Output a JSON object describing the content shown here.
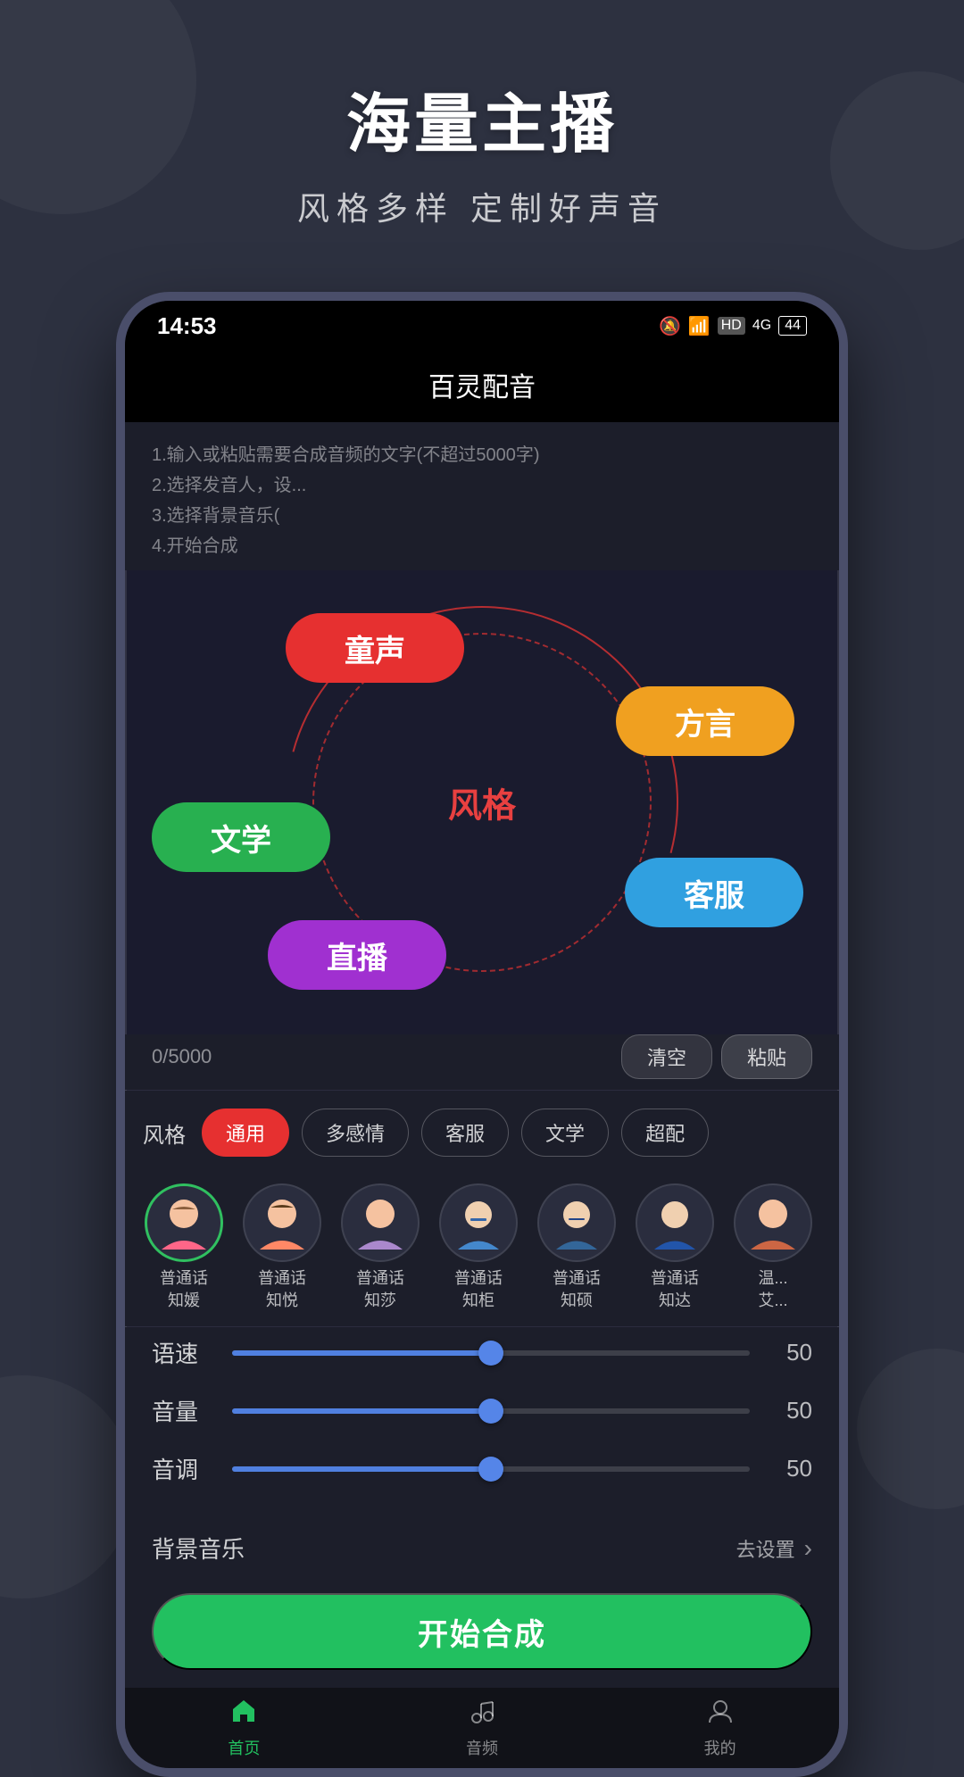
{
  "page": {
    "bg_title": "海量主播",
    "bg_subtitle": "风格多样   定制好声音"
  },
  "status_bar": {
    "time": "14:53",
    "icons": "🔕 📶 HD 4G 🔋"
  },
  "app_header": {
    "title": "百灵配音"
  },
  "instructions": {
    "lines": [
      "1.输入或粘贴需要合成音频的文字(不超过5000字)",
      "2.选择发音人，设...",
      "3.选择背景音乐(",
      "4.开始合成"
    ]
  },
  "style_wheel": {
    "center_label": "风格",
    "pills": [
      {
        "id": "tongsheng",
        "label": "童声",
        "color": "#e63030",
        "pos": "top-left"
      },
      {
        "id": "fangyan",
        "label": "方言",
        "color": "#f0a020",
        "pos": "top-right"
      },
      {
        "id": "wenxue",
        "label": "文学",
        "color": "#28b050",
        "pos": "mid-left"
      },
      {
        "id": "kefu",
        "label": "客服",
        "color": "#30a0e0",
        "pos": "mid-right"
      },
      {
        "id": "zhibo",
        "label": "直播",
        "color": "#a030d0",
        "pos": "bottom-center"
      }
    ]
  },
  "counter": {
    "text": "0/5000"
  },
  "action_buttons": {
    "clear": "清空",
    "paste": "粘贴"
  },
  "style_filters": {
    "label": "风格",
    "items": [
      {
        "id": "tongyong",
        "label": "通用",
        "active": true
      },
      {
        "id": "duoganqing",
        "label": "多感情",
        "active": false
      },
      {
        "id": "kefu",
        "label": "客服",
        "active": false
      },
      {
        "id": "wenxue",
        "label": "文学",
        "active": false
      },
      {
        "id": "chao",
        "label": "超配",
        "active": false
      }
    ]
  },
  "voice_avatars": [
    {
      "name": "普通话\n知媛",
      "emoji": "👩",
      "selected": true
    },
    {
      "name": "普通话\n知悦",
      "emoji": "👧",
      "selected": false
    },
    {
      "name": "普通话\n知莎",
      "emoji": "👩",
      "selected": false
    },
    {
      "name": "普通话\n知柜",
      "emoji": "👨",
      "selected": false
    },
    {
      "name": "普通话\n知硕",
      "emoji": "👨",
      "selected": false
    },
    {
      "name": "普通话\n知达",
      "emoji": "👨",
      "selected": false
    },
    {
      "name": "温...\n艾...",
      "emoji": "👩",
      "selected": false
    }
  ],
  "sliders": [
    {
      "label": "语速",
      "value": 50,
      "percent": 50
    },
    {
      "label": "音量",
      "value": 50,
      "percent": 50
    },
    {
      "label": "音调",
      "value": 50,
      "percent": 50
    }
  ],
  "bg_music": {
    "label": "背景音乐",
    "settings_label": "去设置"
  },
  "start_button": {
    "label": "开始合成"
  },
  "bottom_nav": {
    "items": [
      {
        "id": "home",
        "label": "首页",
        "icon": "🏠",
        "active": true
      },
      {
        "id": "music",
        "label": "音频",
        "icon": "🎵",
        "active": false
      },
      {
        "id": "settings",
        "label": "我的",
        "icon": "⚙️",
        "active": false
      }
    ]
  }
}
